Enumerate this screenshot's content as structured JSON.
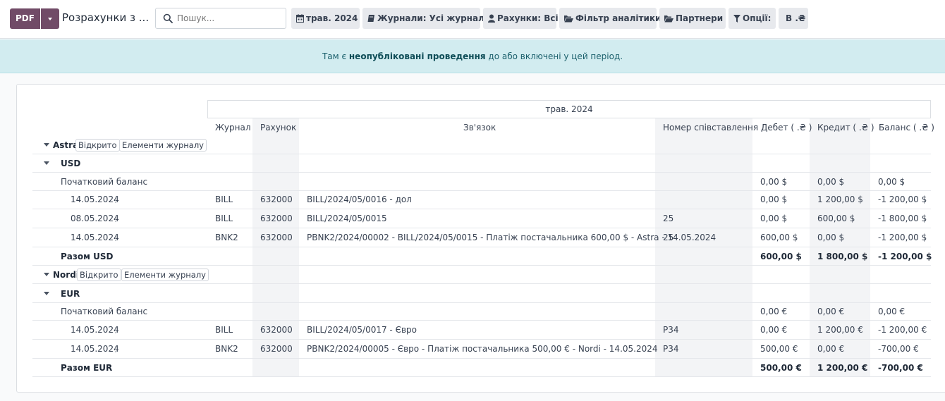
{
  "control_panel": {
    "pdf_label": "PDF",
    "breadcrumb": "Розрахунки з ...",
    "search_placeholder": "Пошук...",
    "filters": [
      {
        "label": "трав. 2024",
        "icon": "calendar-icon"
      },
      {
        "label": "Журнали: Усі журнали",
        "icon": "book-icon"
      },
      {
        "label": "Рахунки: Всі",
        "icon": "user-icon"
      },
      {
        "label": "Фільтр аналітики",
        "icon": "folder-open-icon"
      },
      {
        "label": "Партнери",
        "icon": "folder-open-icon"
      },
      {
        "label": "Опції:",
        "icon": "filter-icon"
      },
      {
        "label": "В .₴",
        "icon": ""
      }
    ]
  },
  "alert": {
    "prefix": "Там є ",
    "link": "неопубліковані проведення",
    "suffix": " до або включені у цей період."
  },
  "report": {
    "period": "трав. 2024",
    "columns": [
      "Журнал",
      "Рахунок",
      "Зв'язок",
      "Номер співставлення",
      "Дебет ( .₴ )",
      "Кредит ( .₴ )",
      "Баланс ( .₴ )"
    ],
    "partners": [
      {
        "name": "Astra",
        "btn_open": "Відкрито",
        "btn_items": "Елементи журналу",
        "currency": "USD",
        "opening": {
          "label": "Початковий баланс",
          "debit": "0,00 $",
          "credit": "0,00 $",
          "balance": "0,00 $"
        },
        "lines": [
          {
            "date": "14.05.2024",
            "journal": "BILL",
            "account": "632000",
            "ref": "BILL/2024/05/0016 - дол",
            "matching": "",
            "debit": "0,00 $",
            "credit": "1 200,00 $",
            "balance": "-1 200,00 $"
          },
          {
            "date": "08.05.2024",
            "journal": "BILL",
            "account": "632000",
            "ref": "BILL/2024/05/0015",
            "matching": "25",
            "debit": "0,00 $",
            "credit": "600,00 $",
            "balance": "-1 800,00 $"
          },
          {
            "date": "14.05.2024",
            "journal": "BNK2",
            "account": "632000",
            "ref": "PBNK2/2024/00002 - BILL/2024/05/0015 - Платіж постачальника 600,00 $ - Astra - 14.05.2024",
            "matching": "25",
            "debit": "600,00 $",
            "credit": "0,00 $",
            "balance": "-1 200,00 $"
          }
        ],
        "total": {
          "label": "Разом USD",
          "debit": "600,00 $",
          "credit": "1 800,00 $",
          "balance": "-1 200,00 $"
        }
      },
      {
        "name": "Nordi",
        "btn_open": "Відкрито",
        "btn_items": "Елементи журналу",
        "currency": "EUR",
        "opening": {
          "label": "Початковий баланс",
          "debit": "0,00 €",
          "credit": "0,00 €",
          "balance": "0,00 €"
        },
        "lines": [
          {
            "date": "14.05.2024",
            "journal": "BILL",
            "account": "632000",
            "ref": "BILL/2024/05/0017 - Євро",
            "matching": "P34",
            "debit": "0,00 €",
            "credit": "1 200,00 €",
            "balance": "-1 200,00 €"
          },
          {
            "date": "14.05.2024",
            "journal": "BNK2",
            "account": "632000",
            "ref": "PBNK2/2024/00005 - Євро - Платіж постачальника 500,00 € - Nordi - 14.05.2024",
            "matching": "P34",
            "debit": "500,00 €",
            "credit": "0,00 €",
            "balance": "-700,00 €"
          }
        ],
        "total": {
          "label": "Разом EUR",
          "debit": "500,00 €",
          "credit": "1 200,00 €",
          "balance": "-700,00 €"
        }
      }
    ]
  }
}
